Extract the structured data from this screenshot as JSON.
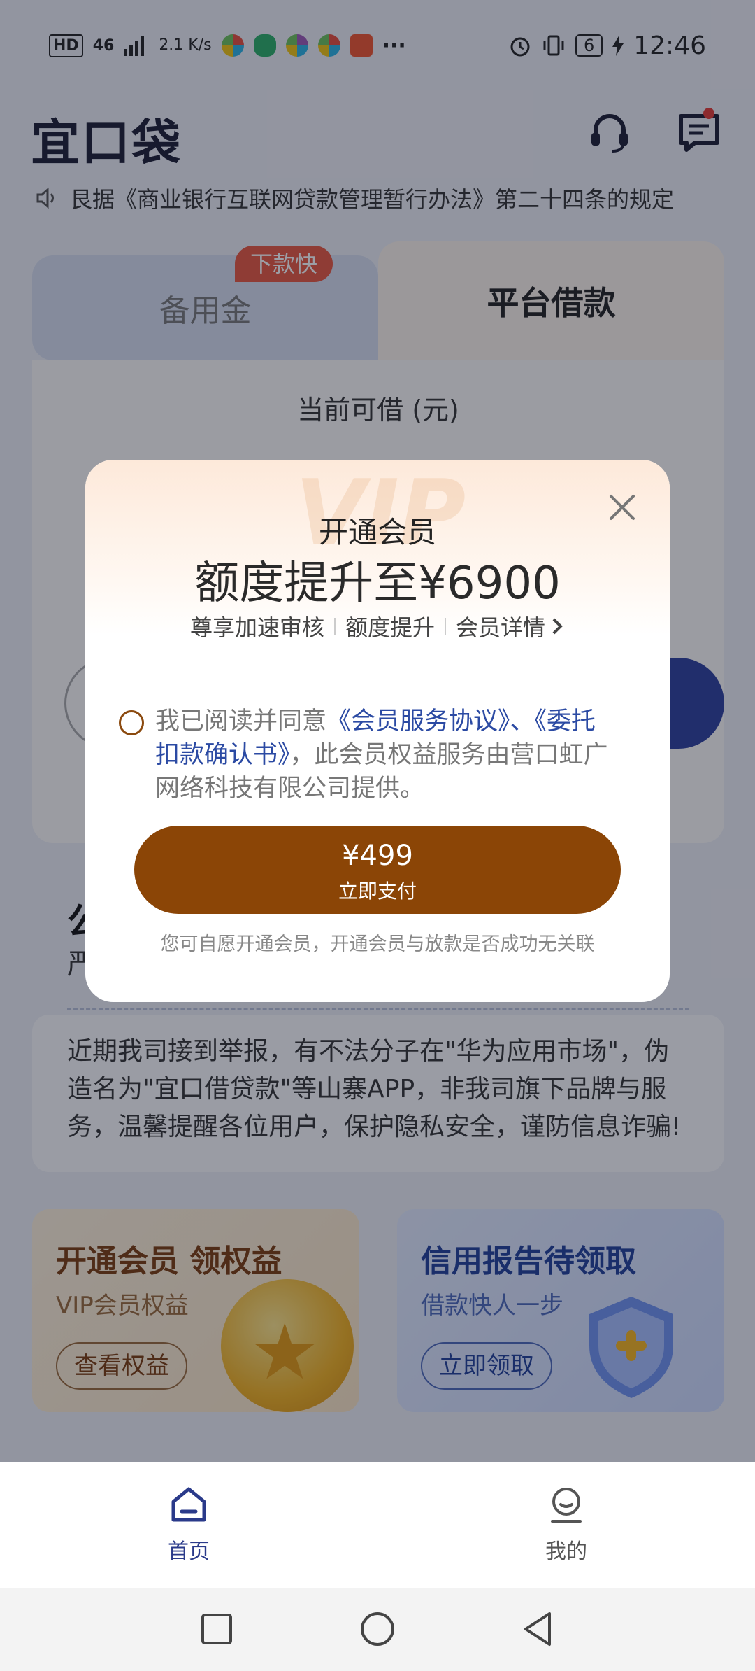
{
  "status_bar": {
    "hd": "HD",
    "signal": "46",
    "speed": "2.1 K/s",
    "more": "···",
    "battery": "6",
    "time": "12:46"
  },
  "header": {
    "logo": "宜口袋",
    "notice": "艮据《商业银行互联网贷款管理暂行办法》第二十四条的规定"
  },
  "tabs": {
    "left_label": "备用金",
    "left_badge": "下款快",
    "right_label": "平台借款"
  },
  "main_card": {
    "available_label": "当前可借 (元)",
    "partial_title": "公",
    "partial_sub": "严"
  },
  "warning": {
    "text": "近期我司接到举报，有不法分子在\"华为应用市场\"，伪造名为\"宜口借贷款\"等山寨APP，非我司旗下品牌与服务，温馨提醒各位用户，保护隐私安全，谨防信息诈骗!"
  },
  "promos": {
    "vip": {
      "title": "开通会员 领权益",
      "subtitle": "VIP会员权益",
      "button": "查看权益"
    },
    "credit": {
      "title": "信用报告待领取",
      "subtitle": "借款快人一步",
      "button": "立即领取"
    }
  },
  "modal": {
    "title": "开通会员",
    "headline": "额度提升至¥6900",
    "benefits": [
      "尊享加速审核",
      "额度提升",
      "会员详情"
    ],
    "agree_prefix": "我已阅读并同意",
    "agree_link_1": "《会员服务协议》",
    "agree_sep": "、",
    "agree_link_2": "《委托扣款确认书》",
    "agree_suffix": "，此会员权益服务由营口虹广网络科技有限公司提供。",
    "pay_amount": "¥499",
    "pay_label": "立即支付",
    "note": "您可自愿开通会员，开通会员与放款是否成功无关联"
  },
  "bottom_nav": {
    "home": "首页",
    "mine": "我的"
  },
  "colors": {
    "pay_button": "#8b4506",
    "link": "#2b4aa3",
    "badge": "#e9573f"
  }
}
